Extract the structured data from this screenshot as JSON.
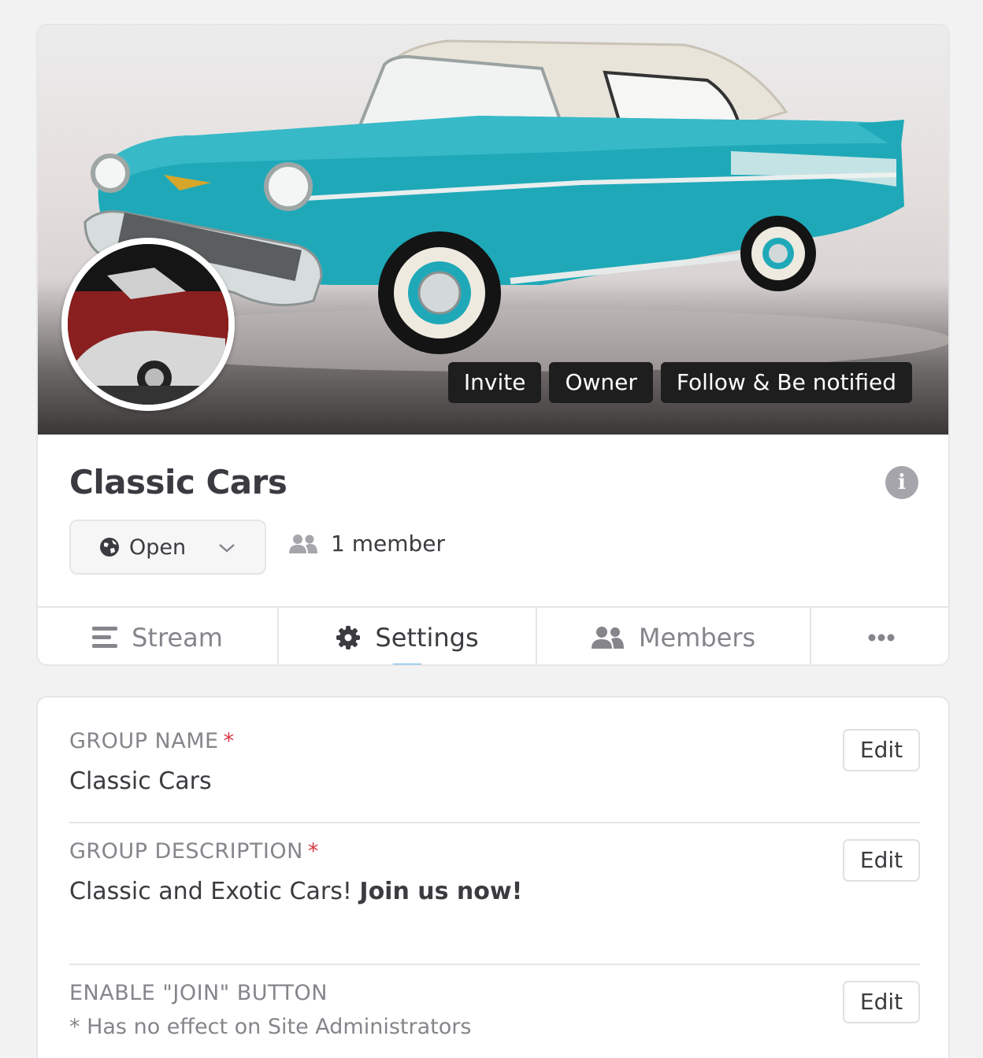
{
  "cover": {
    "actions": {
      "invite": "Invite",
      "owner": "Owner",
      "follow": "Follow & Be notified"
    }
  },
  "group": {
    "title": "Classic Cars",
    "privacy": "Open",
    "members": "1 member"
  },
  "tabs": [
    {
      "label": "Stream",
      "icon": "stream-icon"
    },
    {
      "label": "Settings",
      "icon": "gear-icon",
      "active": true
    },
    {
      "label": "Members",
      "icon": "users-icon"
    },
    {
      "label": "",
      "icon": "more-icon"
    }
  ],
  "settings": {
    "name": {
      "label": "GROUP NAME",
      "required": "*",
      "value": "Classic Cars",
      "edit": "Edit"
    },
    "description": {
      "label": "GROUP DESCRIPTION",
      "required": "*",
      "value_plain": "Classic and Exotic Cars! ",
      "value_bold": "Join us now!",
      "edit": "Edit"
    },
    "join": {
      "label": "ENABLE \"JOIN\" BUTTON",
      "note": "* Has no effect on Site Administrators",
      "edit": "Edit"
    }
  },
  "colors": {
    "accent": "#5cb3ea",
    "required": "#d9363e",
    "car": "#1fa9b8"
  }
}
